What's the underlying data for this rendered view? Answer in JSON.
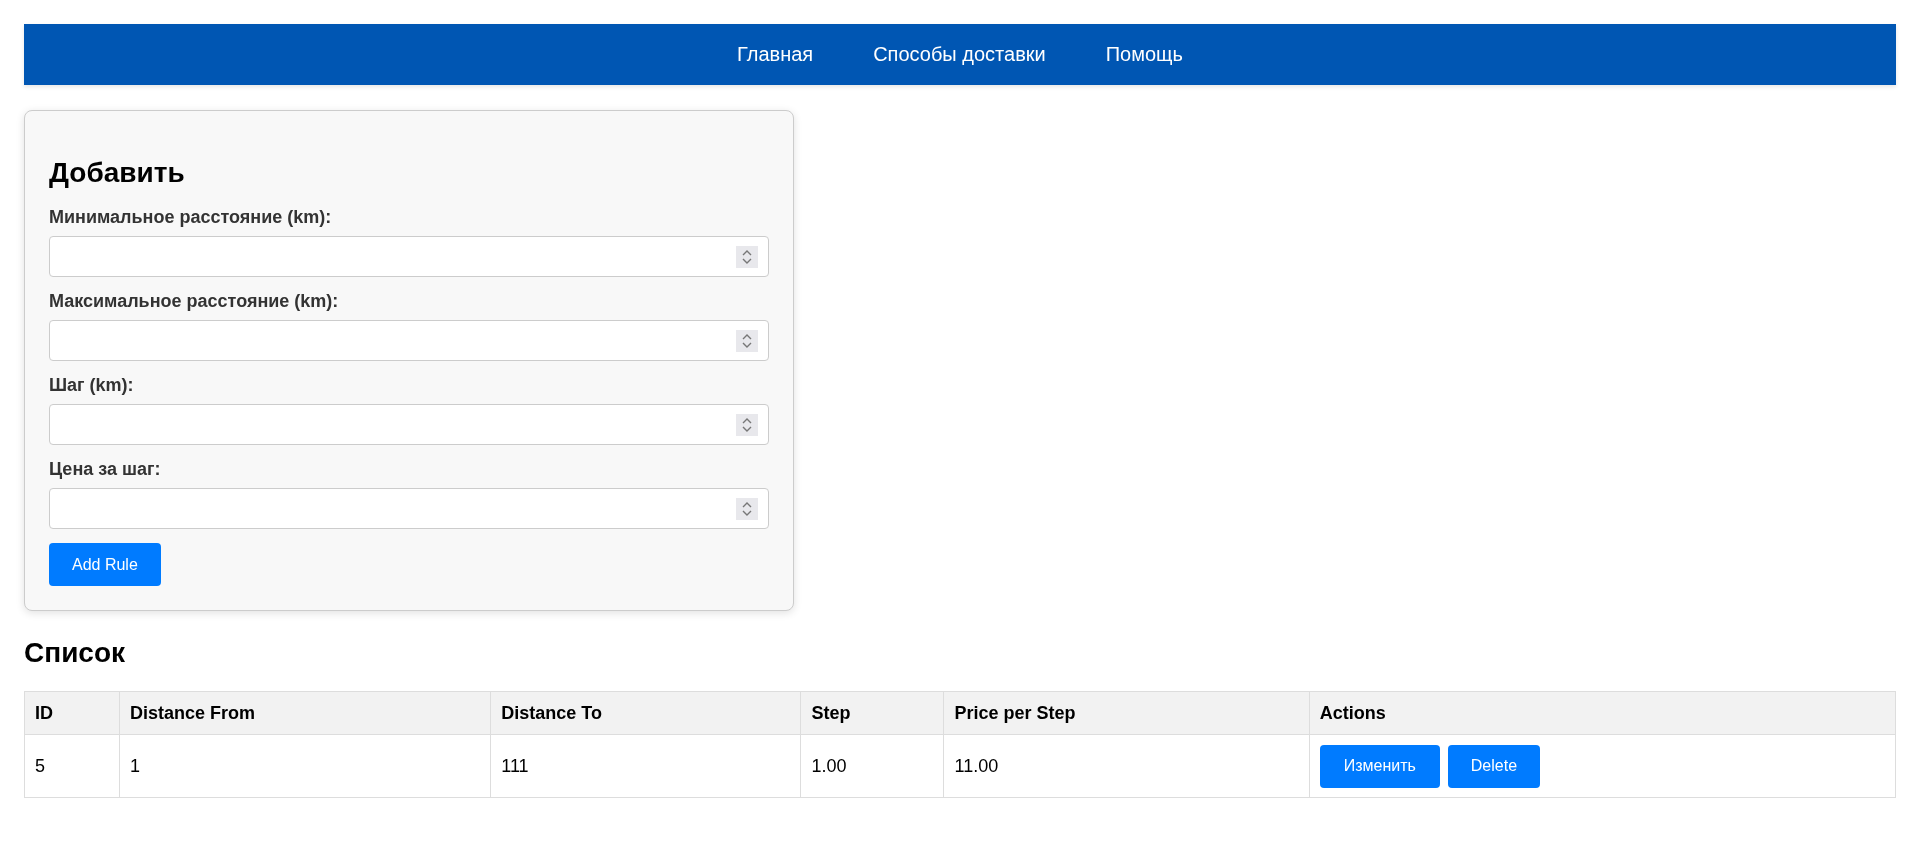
{
  "nav": [
    {
      "label": "Главная"
    },
    {
      "label": "Способы доставки"
    },
    {
      "label": "Помощь"
    }
  ],
  "form": {
    "title": "Добавить",
    "fields": [
      {
        "label": "Минимальное расстояние (km):"
      },
      {
        "label": "Максимальное расстояние (km):"
      },
      {
        "label": "Шаг (km):"
      },
      {
        "label": "Цена за шаг:"
      }
    ],
    "submit": "Add Rule"
  },
  "list": {
    "title": "Список",
    "columns": [
      "ID",
      "Distance From",
      "Distance To",
      "Step",
      "Price per Step",
      "Actions"
    ],
    "rows": [
      {
        "cells": [
          "5",
          "1",
          "111",
          "1.00",
          "11.00"
        ],
        "actions": [
          "Изменить",
          "Delete"
        ]
      }
    ]
  }
}
